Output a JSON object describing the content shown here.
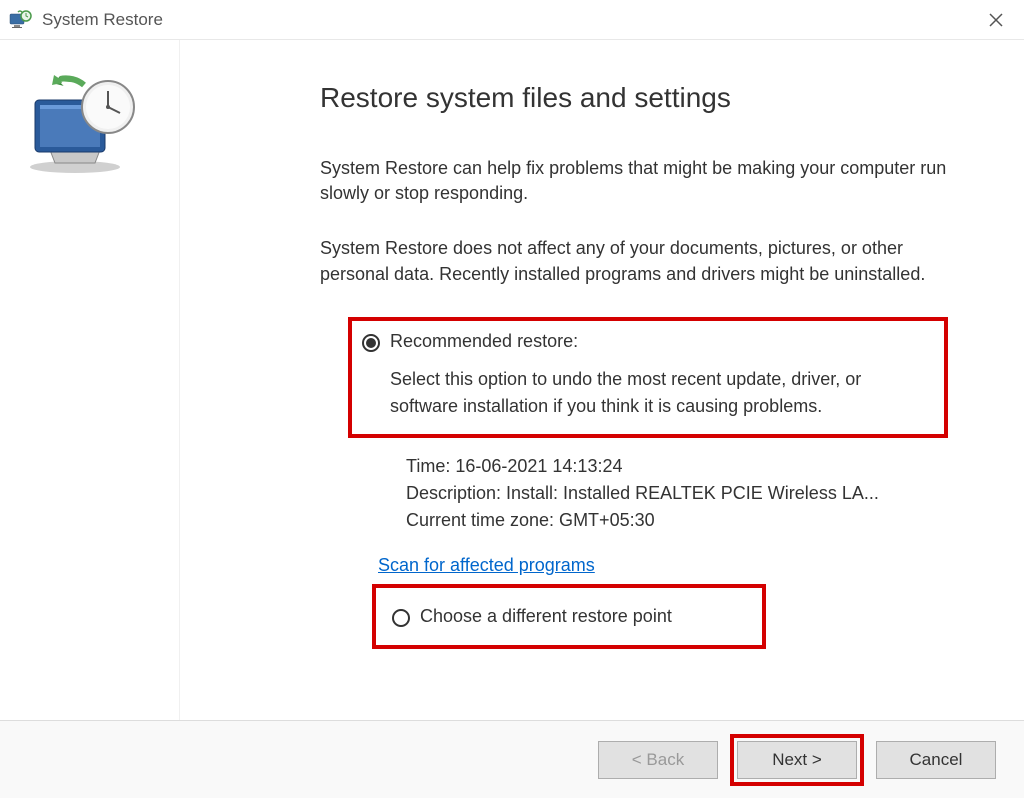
{
  "window": {
    "title": "System Restore"
  },
  "heading": "Restore system files and settings",
  "intro1": "System Restore can help fix problems that might be making your computer run slowly or stop responding.",
  "intro2": "System Restore does not affect any of your documents, pictures, or other personal data. Recently installed programs and drivers might be uninstalled.",
  "option_recommended": {
    "label": "Recommended restore:",
    "desc": "Select this option to undo the most recent update, driver, or software installation if you think it is causing problems.",
    "time_label": "Time: 16-06-2021 14:13:24",
    "description_label": "Description: Install: Installed REALTEK PCIE Wireless LA...",
    "timezone_label": "Current time zone: GMT+05:30"
  },
  "scan_link": "Scan for affected programs",
  "option_different": {
    "label": "Choose a different restore point"
  },
  "buttons": {
    "back": "< Back",
    "next": "Next >",
    "cancel": "Cancel"
  }
}
